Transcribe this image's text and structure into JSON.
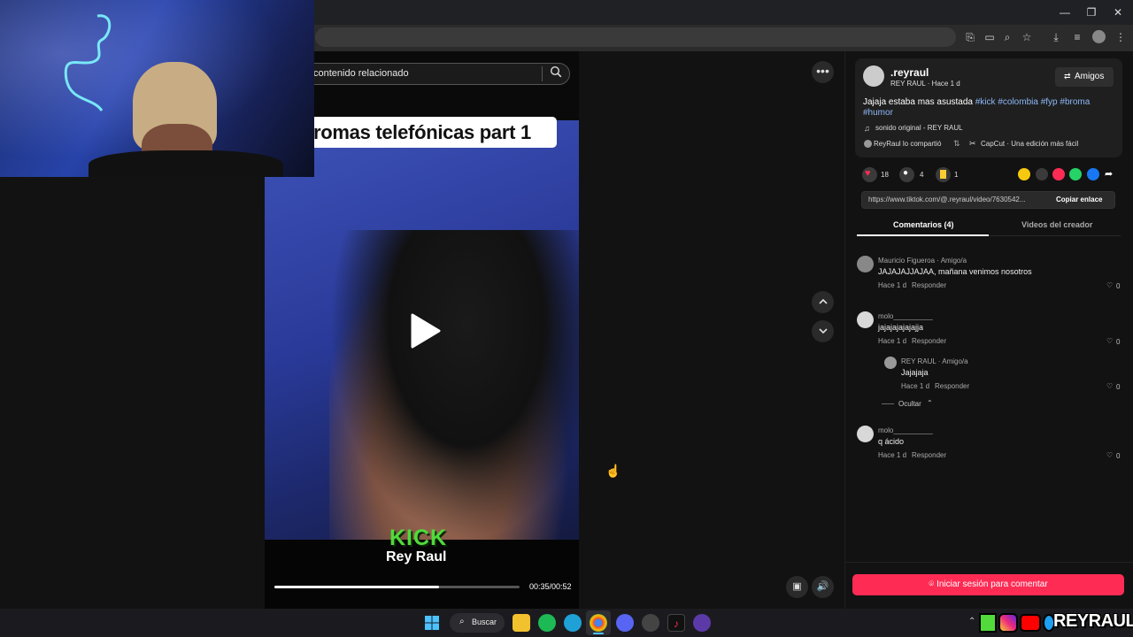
{
  "browser": {
    "window_controls": {
      "minimize": "—",
      "restore": "❐",
      "close": "✕"
    }
  },
  "video": {
    "search_text": "contenido relacionado",
    "caption": "romas telefónicas part 1",
    "overlay_logo": "KICK",
    "overlay_name": "Rey Raul",
    "time": "00:35/00:52",
    "progress": 0.67
  },
  "author": {
    "username": ".reyraul",
    "display_meta": "REY RAUL · Hace 1 d",
    "friends_button": "Amigos",
    "description_text": "Jajaja estaba mas asustada ",
    "hashtags": [
      "#kick",
      "#colombia",
      "#fyp",
      "#broma",
      "#humor"
    ],
    "sound": "sonido original - REY RAUL",
    "shared_by": "ReyRaul lo compartió",
    "capcut": "CapCut · Una edición más fácil"
  },
  "stats": {
    "likes": "18",
    "comments": "4",
    "saves": "1"
  },
  "share": {
    "url": "https://www.tiktok.com/@.reyraul/video/7630542...",
    "copy_label": "Copiar enlace"
  },
  "tabs": [
    {
      "label": "Comentarios (4)"
    },
    {
      "label": "Videos del creador"
    }
  ],
  "comments": [
    {
      "name": "Mauricio Figueroa · Amigo/a",
      "body": "JAJAJAJJAJAA, mañana venimos nosotros",
      "time": "Hace 1 d",
      "reply": "Responder",
      "likes": "0"
    },
    {
      "name": "molo__________",
      "body": "jajajajajajajja",
      "time": "Hace 1 d",
      "reply": "Responder",
      "likes": "0"
    },
    {
      "name": "REY RAUL · Amigo/a",
      "body": "Jajajaja",
      "time": "Hace 1 d",
      "reply": "Responder",
      "likes": "0"
    },
    {
      "name": "molo__________",
      "body": "q ácido",
      "time": "Hace 1 d",
      "reply": "Responder",
      "likes": "0"
    }
  ],
  "hide_replies": "Ocultar",
  "login_button": "Iniciar sesión para comentar",
  "taskbar": {
    "search": "Buscar"
  },
  "brand": {
    "text": "REYRAUL"
  },
  "colors": {
    "accent": "#fe2c55",
    "hashtag": "#8cb8f7",
    "kick_green": "#52d93c"
  }
}
